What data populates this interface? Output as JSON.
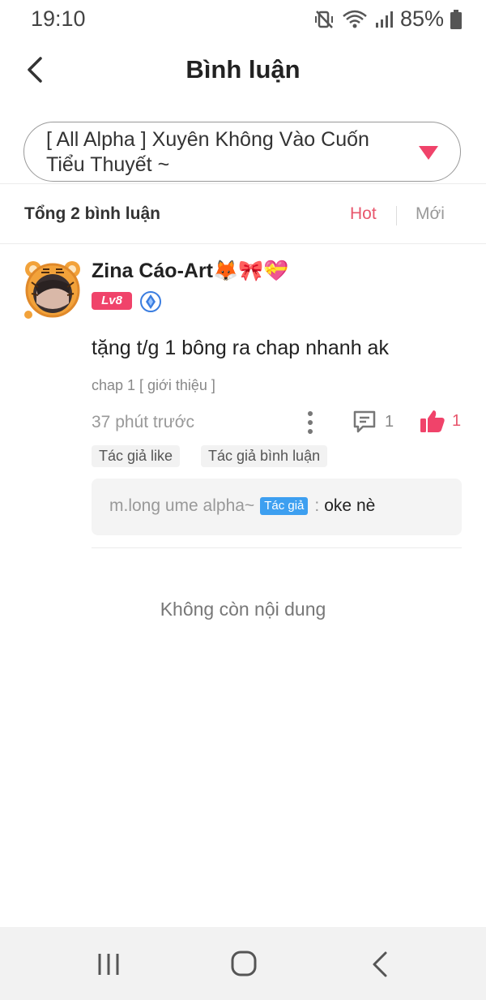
{
  "status_bar": {
    "time": "19:10",
    "battery": "85%",
    "icons": [
      "mute-vibrate-icon",
      "wifi-icon",
      "signal-icon",
      "battery-icon"
    ]
  },
  "header": {
    "title": "Bình luận",
    "back_icon": "chevron-left-icon"
  },
  "book_selector": {
    "title": "[ All Alpha ] Xuyên Không Vào Cuốn Tiểu Thuyết ~",
    "arrow_color": "#f0436a"
  },
  "comments_bar": {
    "count_label": "Tổng 2 bình luận",
    "sort_hot": "Hot",
    "sort_new": "Mới",
    "active_color": "#e8566c"
  },
  "comment": {
    "username": "Zina Cáo-Art🦊🎀💝",
    "level": "Lv8",
    "text": "tặng t/g 1 bông ra chap nhanh ak",
    "chapter": "chap 1 [ giới thiệu ]",
    "time_ago": "37 phút trước",
    "reply_count": "1",
    "like_count": "1",
    "tags": [
      "Tác giả like",
      "Tác giả bình luận"
    ],
    "reply": {
      "user": "m.long ume alpha~",
      "badge": "Tác giả",
      "colon": ":",
      "content": "oke nè"
    }
  },
  "footer": {
    "no_more": "Không còn nội dung"
  },
  "nav": {
    "icons": [
      "recent-apps-icon",
      "home-icon",
      "back-icon"
    ]
  }
}
